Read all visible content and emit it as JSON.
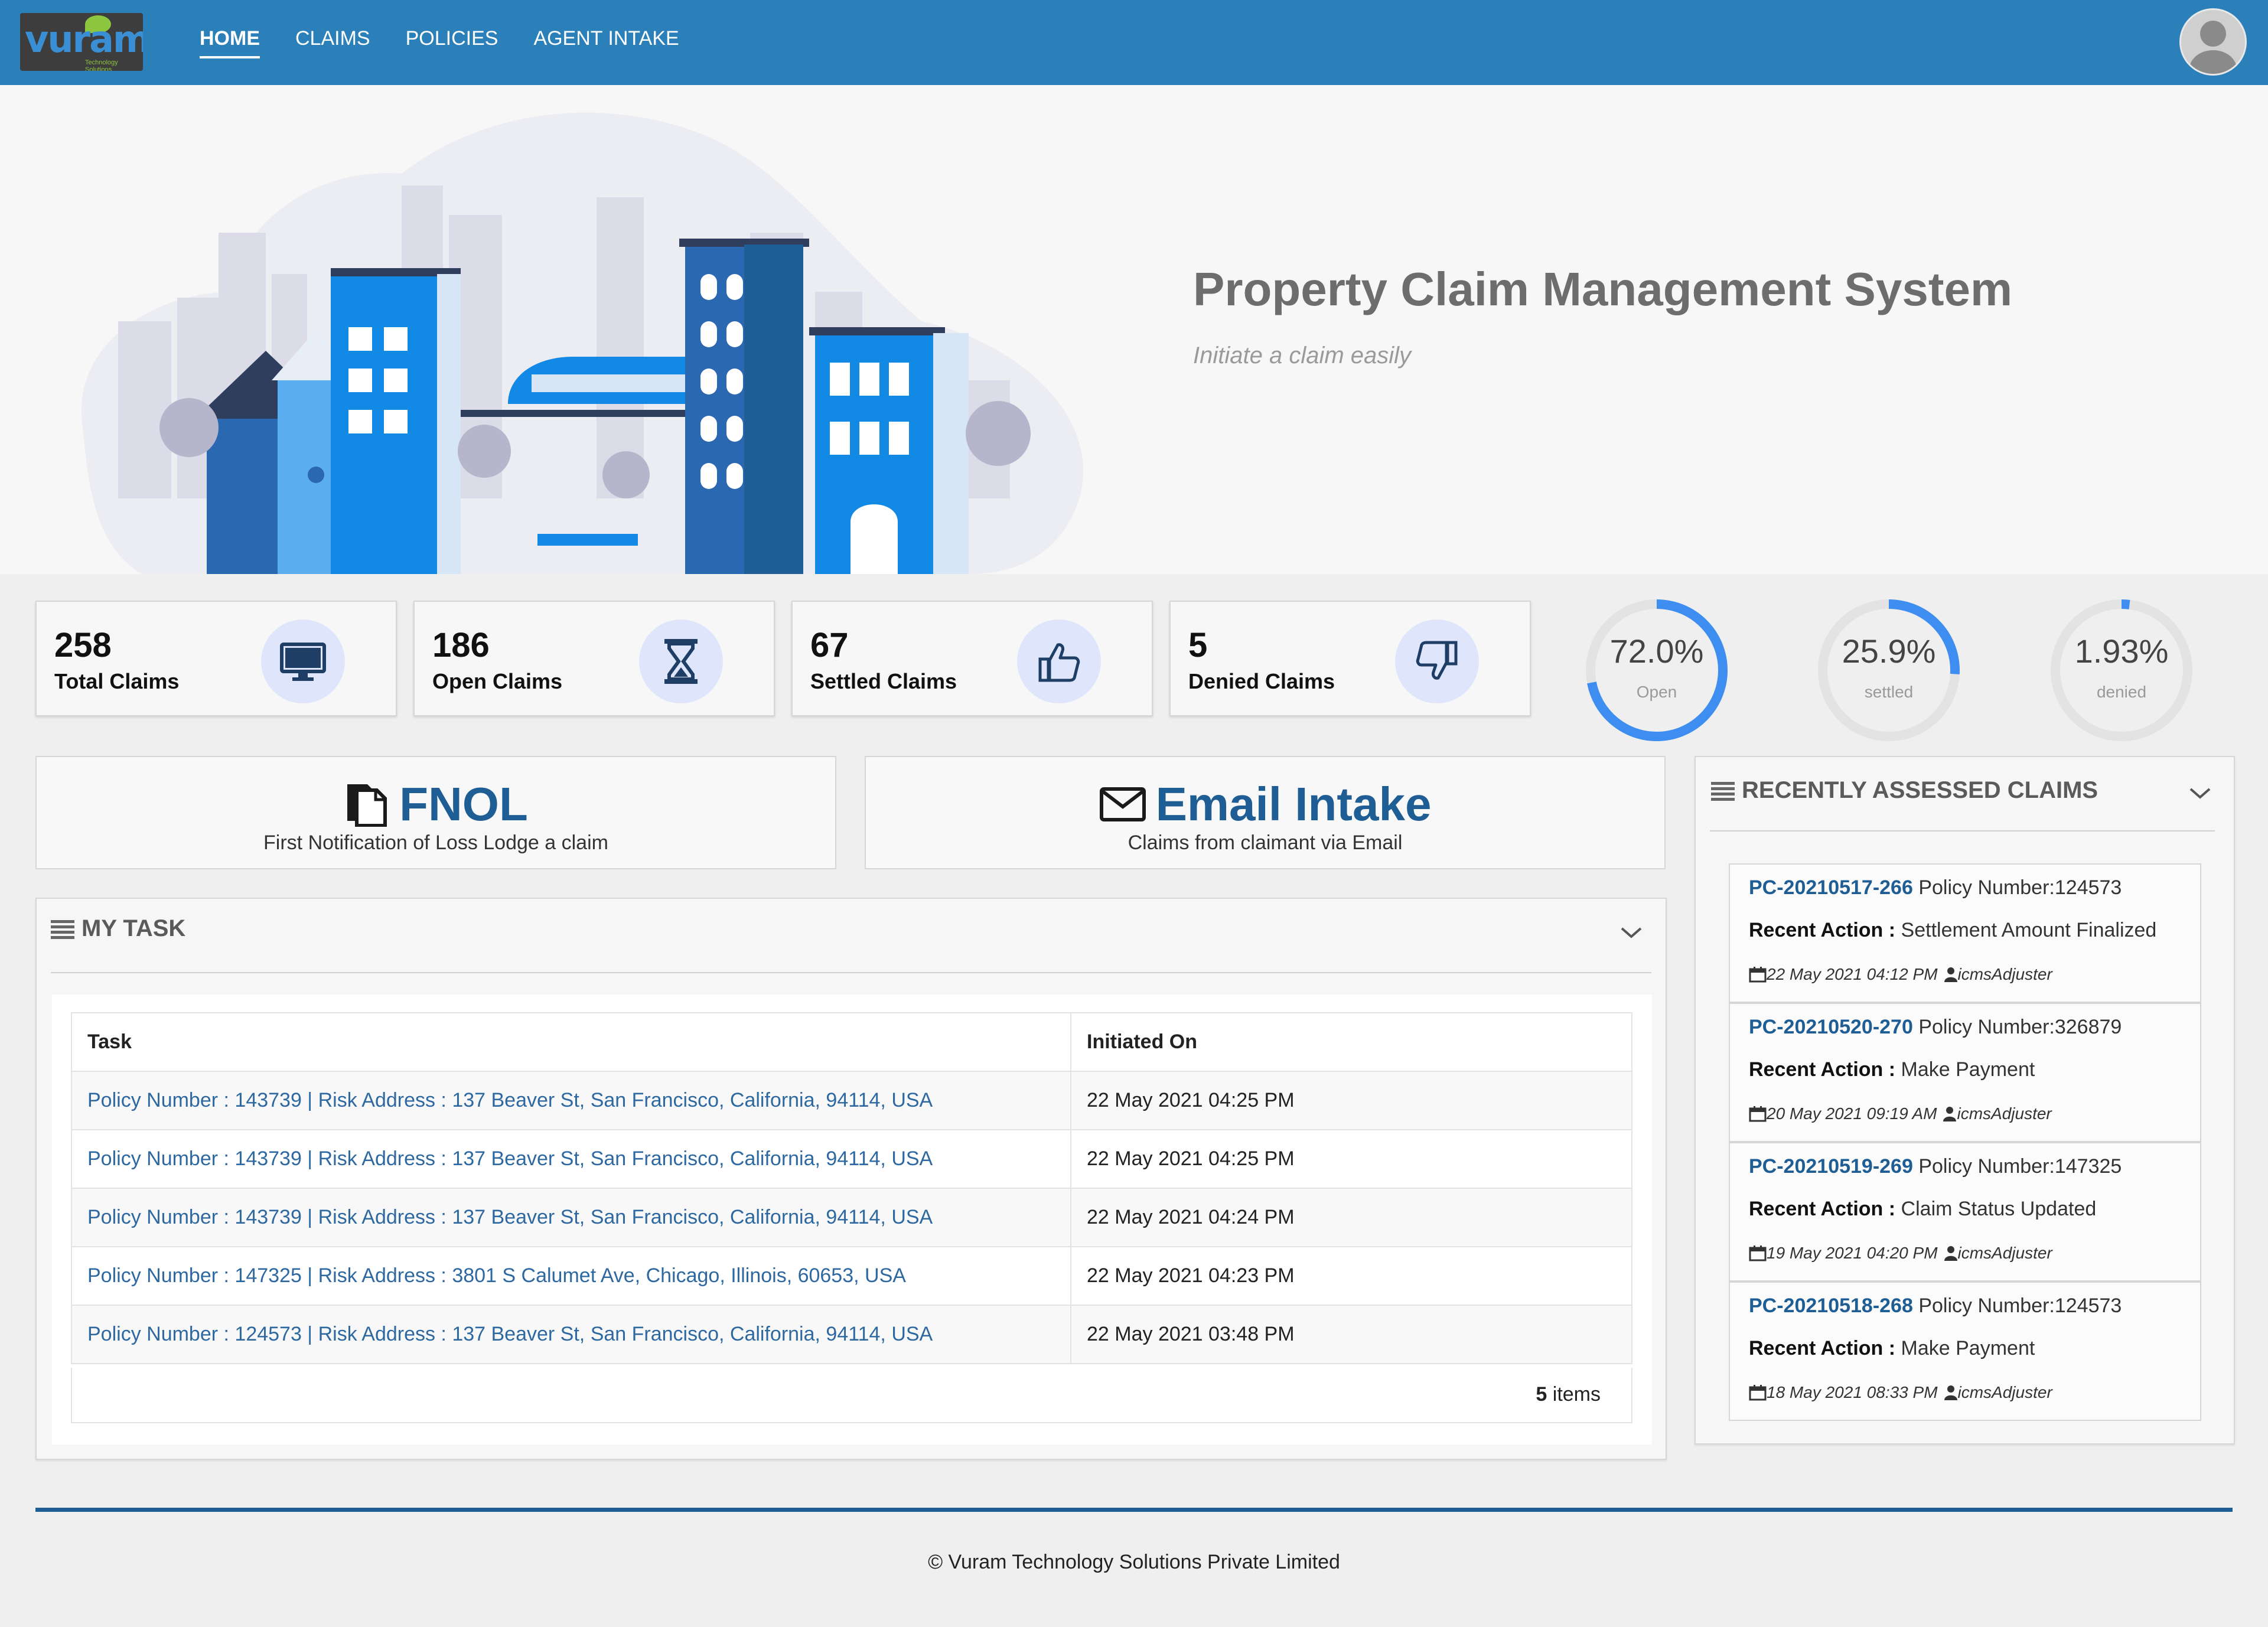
{
  "header": {
    "logo_text": "vuram",
    "logo_subtext": "Technology Solutions",
    "nav": [
      "HOME",
      "CLAIMS",
      "POLICIES",
      "AGENT INTAKE"
    ],
    "active_nav": "HOME"
  },
  "hero": {
    "title": "Property Claim Management System",
    "subtitle": "Initiate a claim easily"
  },
  "stats": [
    {
      "value": "258",
      "label": "Total Claims",
      "icon": "monitor-icon"
    },
    {
      "value": "186",
      "label": "Open Claims",
      "icon": "hourglass-icon"
    },
    {
      "value": "67",
      "label": "Settled Claims",
      "icon": "thumbs-up-icon"
    },
    {
      "value": "5",
      "label": "Denied Claims",
      "icon": "thumbs-down-icon"
    }
  ],
  "gauges": [
    {
      "value": "72.0%",
      "label": "Open",
      "fraction": 0.72
    },
    {
      "value": "25.9%",
      "label": "settled",
      "fraction": 0.259
    },
    {
      "value": "1.93%",
      "label": "denied",
      "fraction": 0.0193
    }
  ],
  "actions": {
    "fnol": {
      "title": "FNOL",
      "subtitle": "First Notification of Loss Lodge a claim",
      "icon": "document-icon"
    },
    "email": {
      "title": "Email Intake",
      "subtitle": "Claims from claimant via Email",
      "icon": "envelope-icon"
    }
  },
  "my_task": {
    "title": "MY TASK",
    "columns": [
      "Task",
      "Initiated On"
    ],
    "rows": [
      {
        "task": "Policy Number : 143739 | Risk Address : 137 Beaver St, San Francisco, California, 94114, USA",
        "initiated": "22 May 2021 04:25 PM"
      },
      {
        "task": "Policy Number : 143739 | Risk Address : 137 Beaver St, San Francisco, California, 94114, USA",
        "initiated": "22 May 2021 04:25 PM"
      },
      {
        "task": "Policy Number : 143739 | Risk Address : 137 Beaver St, San Francisco, California, 94114, USA",
        "initiated": "22 May 2021 04:24 PM"
      },
      {
        "task": "Policy Number : 147325 | Risk Address : 3801 S Calumet Ave, Chicago, Illinois, 60653, USA",
        "initiated": "22 May 2021 04:23 PM"
      },
      {
        "task": "Policy Number : 124573 | Risk Address : 137 Beaver St, San Francisco, California, 94114, USA",
        "initiated": "22 May 2021 03:48 PM"
      }
    ],
    "items_count": "5",
    "items_label": "items"
  },
  "recent_claims": {
    "title": "RECENTLY ASSESSED CLAIMS",
    "action_label": "Recent Action :",
    "items": [
      {
        "id": "PC-20210517-266",
        "policy": "Policy Number:124573",
        "action": "Settlement Amount Finalized",
        "date": "22 May 2021 04:12 PM",
        "user": "icmsAdjuster"
      },
      {
        "id": "PC-20210520-270",
        "policy": "Policy Number:326879",
        "action": "Make Payment",
        "date": "20 May 2021 09:19 AM",
        "user": "icmsAdjuster"
      },
      {
        "id": "PC-20210519-269",
        "policy": "Policy Number:147325",
        "action": "Claim Status Updated",
        "date": "19 May 2021 04:20 PM",
        "user": "icmsAdjuster"
      },
      {
        "id": "PC-20210518-268",
        "policy": "Policy Number:124573",
        "action": "Make Payment",
        "date": "18 May 2021 08:33 PM",
        "user": "icmsAdjuster"
      }
    ]
  },
  "footer": {
    "copyright": "© Vuram Technology Solutions Private Limited"
  },
  "colors": {
    "header_bg": "#2b80b9",
    "accent": "#1f5e94",
    "link": "#2e68a0",
    "gauge_fill": "#3d8ef0",
    "gauge_track": "#e3e3e3",
    "icon_bg": "#dfe6fb"
  }
}
